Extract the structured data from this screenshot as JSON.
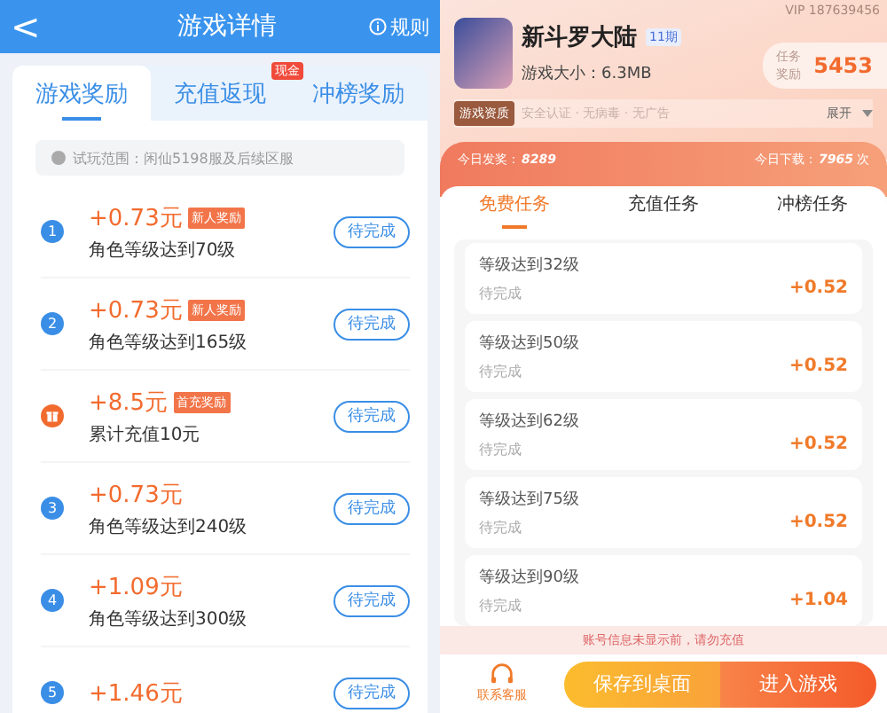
{
  "left": {
    "header": {
      "back": "<",
      "title": "游戏详情",
      "rules": "规则"
    },
    "tabs": [
      {
        "label": "游戏奖励",
        "selected": true
      },
      {
        "label": "充值返现",
        "selected": false,
        "badge": "现金"
      },
      {
        "label": "冲榜奖励",
        "selected": false
      }
    ],
    "notice": "试玩范围：闲仙5198服及后续区服",
    "rewards": [
      {
        "kind": "level",
        "index": "1",
        "amount": "+0.73元",
        "tag": "新人奖励",
        "condition": "角色等级达到70级",
        "button": "待完成"
      },
      {
        "kind": "level",
        "index": "2",
        "amount": "+0.73元",
        "tag": "新人奖励",
        "condition": "角色等级达到165级",
        "button": "待完成"
      },
      {
        "kind": "gift",
        "amount": "+8.5元",
        "tag": "首充奖励",
        "condition": "累计充值10元",
        "button": "待完成"
      },
      {
        "kind": "level",
        "index": "3",
        "amount": "+0.73元",
        "condition": "角色等级达到240级",
        "button": "待完成"
      },
      {
        "kind": "level",
        "index": "4",
        "amount": "+1.09元",
        "condition": "角色等级达到300级",
        "button": "待完成"
      },
      {
        "kind": "level",
        "index": "5",
        "amount": "+1.46元",
        "button": "待完成"
      }
    ]
  },
  "right": {
    "vip": "VIP 187639456",
    "game": {
      "name": "新斗罗大陆",
      "issue": "11期",
      "size": "游戏大小：6.3MB"
    },
    "task_reward": {
      "label": "任务奖励",
      "value": "5453"
    },
    "qualification": {
      "tag": "游戏资质",
      "text": "安全认证 · 无病毒 · 无广告",
      "expand": "展开"
    },
    "stats": {
      "today_award_label": "今日发奖：",
      "today_award": "8289",
      "today_download_label": "今日下载：",
      "today_download": "7965",
      "unit": "次"
    },
    "tabs": [
      {
        "label": "免费任务",
        "selected": true
      },
      {
        "label": "充值任务",
        "selected": false
      },
      {
        "label": "冲榜任务",
        "selected": false
      }
    ],
    "tasks": [
      {
        "title": "等级达到32级",
        "status": "待完成",
        "reward": "+0.52"
      },
      {
        "title": "等级达到50级",
        "status": "待完成",
        "reward": "+0.52"
      },
      {
        "title": "等级达到62级",
        "status": "待完成",
        "reward": "+0.52"
      },
      {
        "title": "等级达到75级",
        "status": "待完成",
        "reward": "+0.52"
      },
      {
        "title": "等级达到90级",
        "status": "待完成",
        "reward": "+1.04"
      }
    ],
    "warning": "账号信息未显示前，请勿充值",
    "footer": {
      "service": "联系客服",
      "save": "保存到桌面",
      "enter": "进入游戏"
    }
  }
}
